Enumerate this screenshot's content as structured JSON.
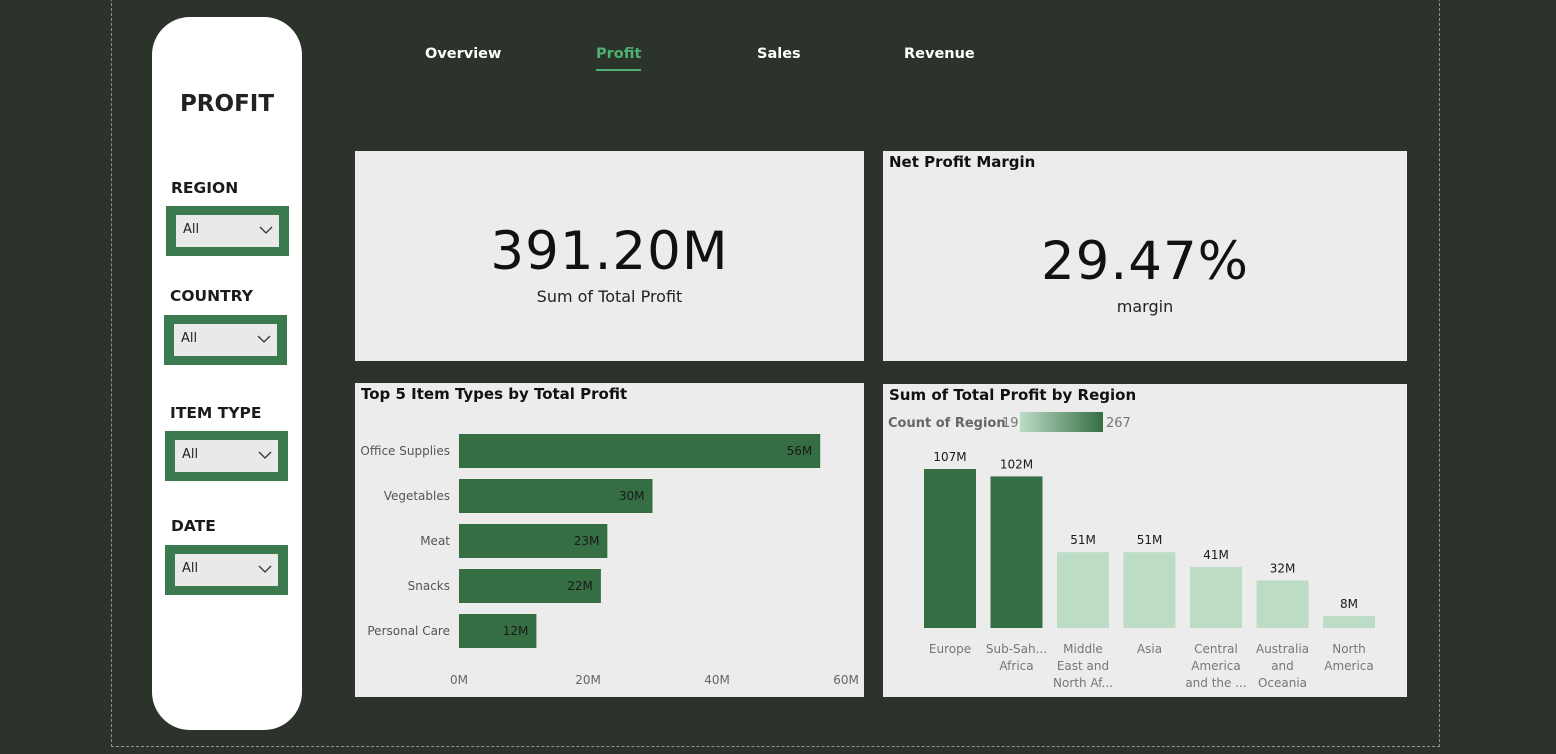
{
  "sidebar": {
    "title": "PROFIT",
    "filters": [
      {
        "label": "REGION",
        "value": "All"
      },
      {
        "label": "COUNTRY",
        "value": "All"
      },
      {
        "label": "ITEM TYPE",
        "value": "All"
      },
      {
        "label": "DATE",
        "value": "All"
      }
    ]
  },
  "nav": {
    "tabs": [
      {
        "label": "Overview",
        "active": false
      },
      {
        "label": "Profit",
        "active": true
      },
      {
        "label": "Sales",
        "active": false
      },
      {
        "label": "Revenue",
        "active": false
      }
    ]
  },
  "kpis": {
    "total_profit": {
      "value": "391.20M",
      "label": "Sum of Total Profit"
    },
    "margin": {
      "title": "Net Profit Margin",
      "value": "29.47%",
      "label": "margin"
    }
  },
  "colors": {
    "dark_green": "#356e42",
    "light_green": "#bcdcc6",
    "accent": "#4fb072"
  },
  "chart_data": [
    {
      "type": "bar",
      "orientation": "horizontal",
      "title": "Top 5 Item Types by Total Profit",
      "categories": [
        "Office Supplies",
        "Vegetables",
        "Meat",
        "Snacks",
        "Personal Care"
      ],
      "values": [
        56,
        30,
        23,
        22,
        12
      ],
      "data_labels": [
        "56M",
        "30M",
        "23M",
        "22M",
        "12M"
      ],
      "xlim": [
        0,
        60
      ],
      "x_ticks": [
        "0M",
        "20M",
        "40M",
        "60M"
      ],
      "grid": false
    },
    {
      "type": "bar",
      "orientation": "vertical",
      "title": "Sum of Total Profit by Region",
      "color_legend": {
        "label": "Count of Region",
        "min": "19",
        "max": "267"
      },
      "categories": [
        [
          "Europe"
        ],
        [
          "Sub-Sah...",
          "Africa"
        ],
        [
          "Middle",
          "East and",
          "North Af..."
        ],
        [
          "Asia"
        ],
        [
          "Central",
          "America",
          "and the ..."
        ],
        [
          "Australia",
          "and",
          "Oceania"
        ],
        [
          "North",
          "America"
        ]
      ],
      "values": [
        107,
        102,
        51,
        51,
        41,
        32,
        8
      ],
      "data_labels": [
        "107M",
        "102M",
        "51M",
        "51M",
        "41M",
        "32M",
        "8M"
      ],
      "color_level": [
        "high",
        "high",
        "low",
        "low",
        "low",
        "low",
        "low"
      ],
      "grid": false
    }
  ]
}
